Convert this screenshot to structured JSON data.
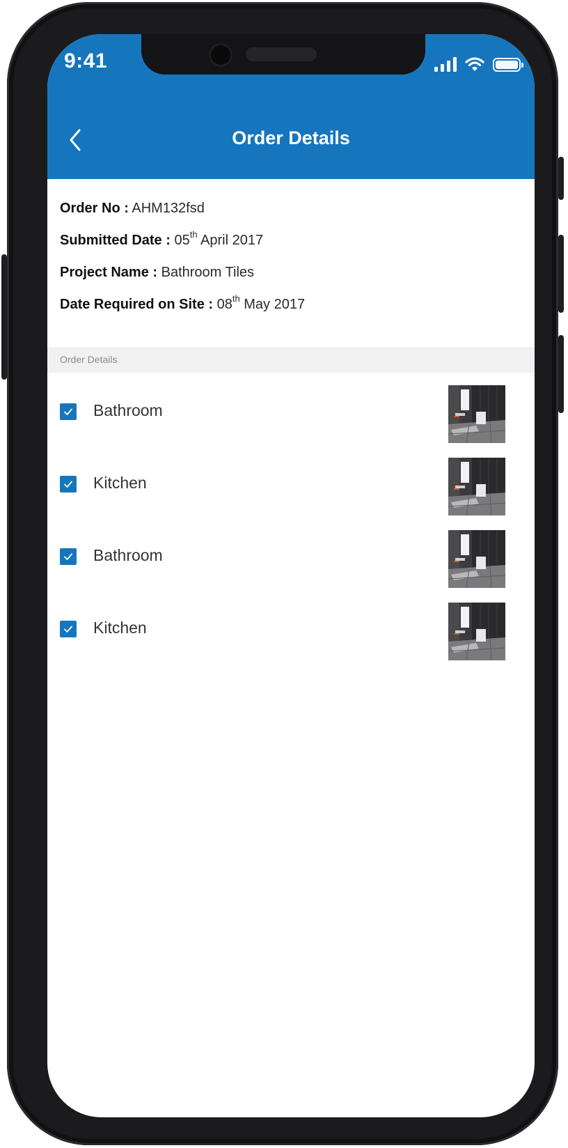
{
  "status_bar": {
    "time": "9:41",
    "icons": [
      "signal-icon",
      "wifi-icon",
      "battery-icon"
    ]
  },
  "header": {
    "title": "Order Details",
    "back_icon": "chevron-left-icon",
    "color": "#1676bd"
  },
  "order": {
    "order_no_label": "Order No :",
    "order_no": "AHM132fsd",
    "submitted_label": "Submitted Date :",
    "submitted_day": "05",
    "submitted_suffix": "th",
    "submitted_rest": "April 2017",
    "project_label": "Project Name :",
    "project_name": "Bathroom Tiles",
    "required_label": "Date Required on Site :",
    "required_day": "08",
    "required_suffix": "th",
    "required_rest": "May 2017"
  },
  "section": {
    "title": "Order Details"
  },
  "items": [
    {
      "label": "Bathroom",
      "checked": true
    },
    {
      "label": "Kitchen",
      "checked": true
    },
    {
      "label": "Bathroom",
      "checked": true
    },
    {
      "label": "Kitchen",
      "checked": true
    }
  ]
}
